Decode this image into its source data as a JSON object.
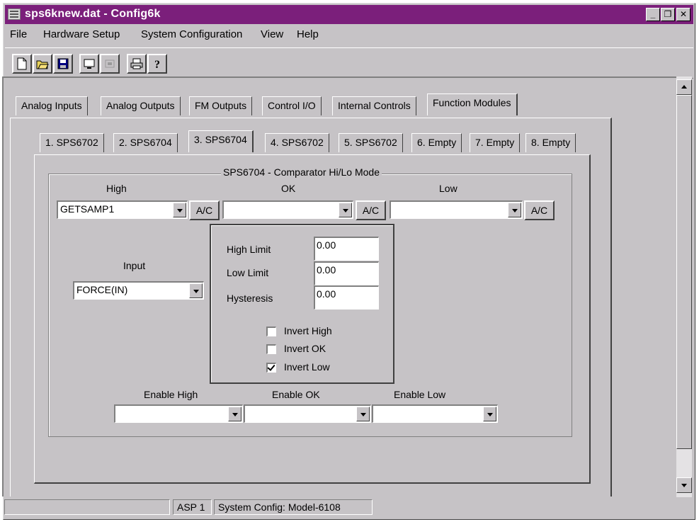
{
  "window": {
    "title": "sps6knew.dat - Config6k"
  },
  "menu": [
    {
      "label": "File"
    },
    {
      "label": "Hardware Setup"
    },
    {
      "label": "System Configuration"
    },
    {
      "label": "View"
    },
    {
      "label": "Help"
    }
  ],
  "toolbar": [
    "new-file-icon",
    "open-folder-icon",
    "save-disk-icon",
    "monitor-icon",
    "disabled-icon",
    "print-icon",
    "help-icon"
  ],
  "main_tabs": [
    {
      "label": "Analog Inputs"
    },
    {
      "label": "Analog Outputs"
    },
    {
      "label": "FM Outputs"
    },
    {
      "label": "Control I/O"
    },
    {
      "label": "Internal Controls"
    },
    {
      "label": "Function Modules",
      "active": true
    }
  ],
  "module_tabs": [
    {
      "label": "1. SPS6702"
    },
    {
      "label": "2. SPS6704"
    },
    {
      "label": "3. SPS6704",
      "active": true
    },
    {
      "label": "4. SPS6702"
    },
    {
      "label": "5. SPS6702"
    },
    {
      "label": "6. Empty"
    },
    {
      "label": "7. Empty"
    },
    {
      "label": "8. Empty"
    }
  ],
  "panel": {
    "group_title": "SPS6704 - Comparator Hi/Lo Mode",
    "high": {
      "label": "High",
      "value": "GETSAMP1",
      "ac": "A/C"
    },
    "ok": {
      "label": "OK",
      "value": "",
      "ac": "A/C"
    },
    "low": {
      "label": "Low",
      "value": "",
      "ac": "A/C"
    },
    "input": {
      "label": "Input",
      "value": "FORCE(IN)"
    },
    "high_limit": {
      "label": "High Limit",
      "value": "0.00"
    },
    "low_limit": {
      "label": "Low Limit",
      "value": "0.00"
    },
    "hysteresis": {
      "label": "Hysteresis",
      "value": "0.00"
    },
    "invert_high": {
      "label": "Invert High",
      "checked": false
    },
    "invert_ok": {
      "label": "Invert OK",
      "checked": false
    },
    "invert_low": {
      "label": "Invert Low",
      "checked": true
    },
    "enable_high": {
      "label": "Enable High",
      "value": ""
    },
    "enable_ok": {
      "label": "Enable OK",
      "value": ""
    },
    "enable_low": {
      "label": "Enable Low",
      "value": ""
    }
  },
  "status": {
    "cell1": "",
    "cell2": "ASP 1",
    "cell3": "System Config: Model-6108"
  }
}
